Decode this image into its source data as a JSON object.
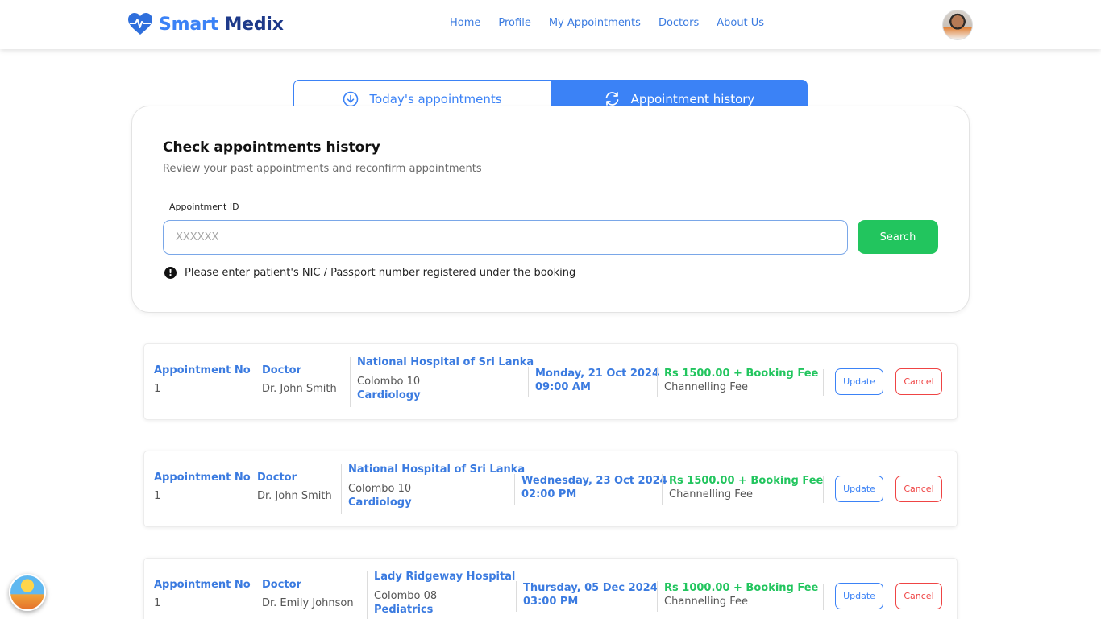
{
  "brand": {
    "smart": "Smart",
    "medix": "Medix",
    "accent": "#3b82f6",
    "dark": "#1e3a8a"
  },
  "nav": {
    "items": [
      "Home",
      "Profile",
      "My Appointments",
      "Doctors",
      "About Us"
    ]
  },
  "tabs": {
    "today": "Today's appointments",
    "history": "Appointment history",
    "active": "history"
  },
  "search": {
    "title": "Check appointments history",
    "subtitle": "Review your past appointments and reconfirm appointments",
    "label": "Appointment ID",
    "placeholder": "XXXXXX",
    "value": "",
    "button": "Search",
    "notice": "Please enter patient's NIC / Passport number registered under the booking"
  },
  "labels": {
    "appointment_no": "Appointment No",
    "doctor": "Doctor",
    "update": "Update",
    "cancel": "Cancel",
    "channelling": "Channelling Fee"
  },
  "appointments": [
    {
      "no": "1",
      "doctor": "Dr. John Smith",
      "hospital": "National Hospital of Sri Lanka",
      "location": "Colombo 10",
      "specialty": "Cardiology",
      "date": "Monday, 21 Oct 2024",
      "time": "09:00 AM",
      "fee": "Rs 1500.00 + Booking Fee"
    },
    {
      "no": "1",
      "doctor": "Dr. John Smith",
      "hospital": "National Hospital of Sri Lanka",
      "location": "Colombo 10",
      "specialty": "Cardiology",
      "date": "Wednesday, 23 Oct 2024",
      "time": "02:00 PM",
      "fee": "Rs 1500.00 + Booking Fee"
    },
    {
      "no": "1",
      "doctor": "Dr. Emily Johnson",
      "hospital": "Lady Ridgeway Hospital",
      "location": "Colombo 08",
      "specialty": "Pediatrics",
      "date": "Thursday, 05 Dec 2024",
      "time": "03:00 PM",
      "fee": "Rs 1000.00 + Booking Fee"
    }
  ]
}
